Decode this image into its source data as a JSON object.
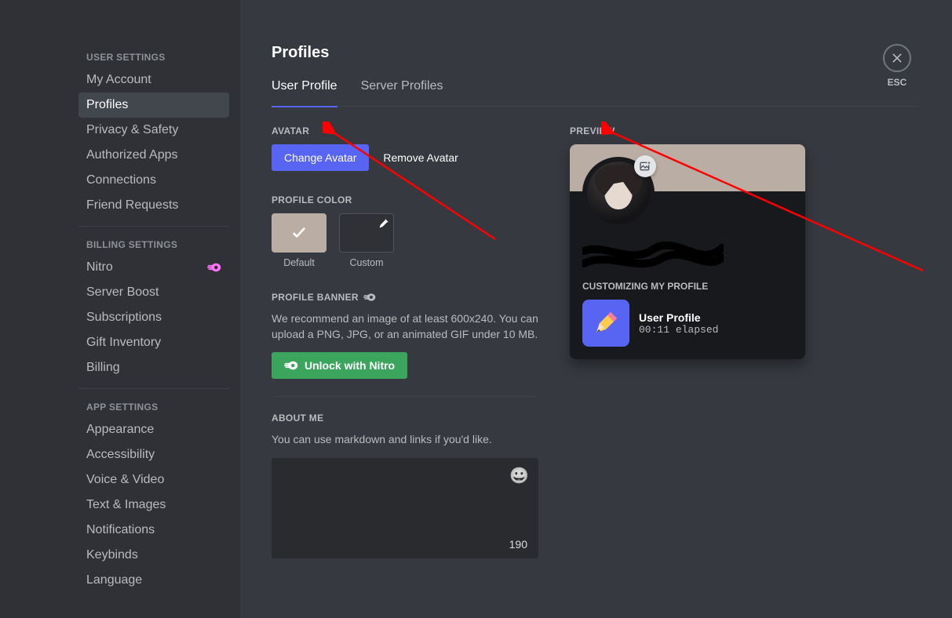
{
  "sidebar": {
    "user_settings_heading": "USER SETTINGS",
    "billing_settings_heading": "BILLING SETTINGS",
    "app_settings_heading": "APP SETTINGS",
    "items_user": [
      {
        "label": "My Account"
      },
      {
        "label": "Profiles"
      },
      {
        "label": "Privacy & Safety"
      },
      {
        "label": "Authorized Apps"
      },
      {
        "label": "Connections"
      },
      {
        "label": "Friend Requests"
      }
    ],
    "items_billing": [
      {
        "label": "Nitro"
      },
      {
        "label": "Server Boost"
      },
      {
        "label": "Subscriptions"
      },
      {
        "label": "Gift Inventory"
      },
      {
        "label": "Billing"
      }
    ],
    "items_app": [
      {
        "label": "Appearance"
      },
      {
        "label": "Accessibility"
      },
      {
        "label": "Voice & Video"
      },
      {
        "label": "Text & Images"
      },
      {
        "label": "Notifications"
      },
      {
        "label": "Keybinds"
      },
      {
        "label": "Language"
      }
    ]
  },
  "page": {
    "title": "Profiles",
    "tabs": [
      {
        "label": "User Profile"
      },
      {
        "label": "Server Profiles"
      }
    ]
  },
  "avatar": {
    "heading": "AVATAR",
    "change_label": "Change Avatar",
    "remove_label": "Remove Avatar"
  },
  "profile_color": {
    "heading": "PROFILE COLOR",
    "default_label": "Default",
    "custom_label": "Custom",
    "default_hex": "#baada3"
  },
  "profile_banner": {
    "heading": "PROFILE BANNER",
    "desc": "We recommend an image of at least 600x240. You can upload a PNG, JPG, or an animated GIF under 10 MB.",
    "unlock_label": "Unlock with Nitro"
  },
  "about_me": {
    "heading": "ABOUT ME",
    "desc": "You can use markdown and links if you'd like.",
    "char_count": "190"
  },
  "preview": {
    "heading": "PREVIEW",
    "section": "CUSTOMIZING MY PROFILE",
    "activity_title": "User Profile",
    "activity_time": "00:11",
    "activity_suffix": " elapsed"
  },
  "esc": {
    "label": "ESC"
  }
}
